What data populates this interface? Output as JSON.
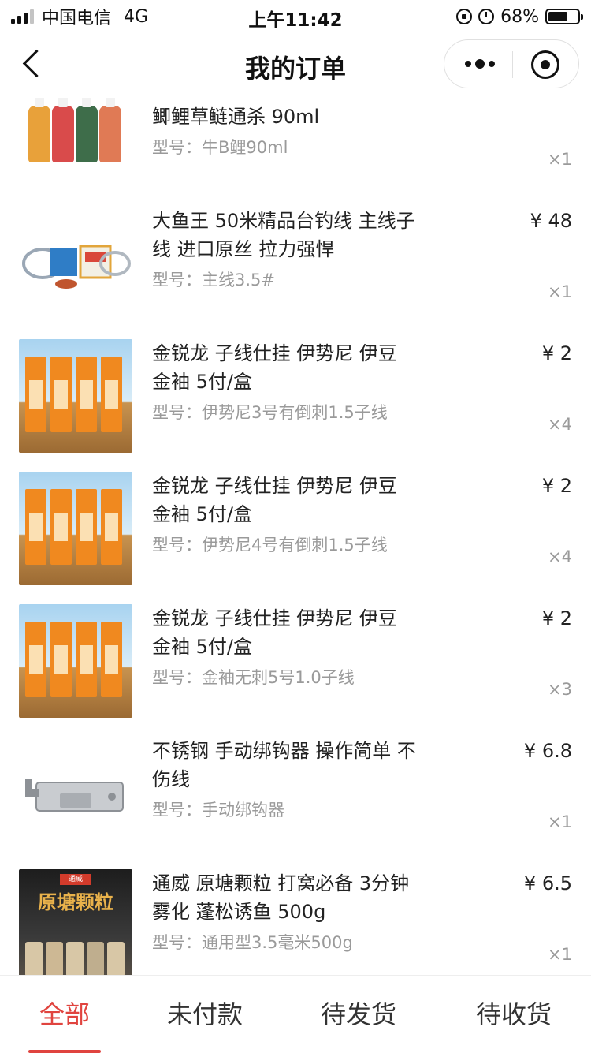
{
  "status_bar": {
    "carrier": "中国电信",
    "network": "4G",
    "time": "上午11:42",
    "battery": "68%",
    "battery_level": 0.68
  },
  "nav": {
    "title": "我的订单"
  },
  "items": [
    {
      "name": "鲫鲤草鲢通杀 90ml",
      "spec": "型号：牛B鲤90ml",
      "price": "",
      "qty": "×1",
      "thumb_icon": "bait-bottles-image"
    },
    {
      "name": "大鱼王 50米精品台钓线 主线子线 进口原丝 拉力强悍",
      "spec": "型号：主线3.5#",
      "price": "¥ 48",
      "qty": "×1",
      "thumb_icon": "fishing-line-image"
    },
    {
      "name": "金锐龙 子线仕挂 伊势尼 伊豆 金袖 5付/盒",
      "spec": "型号：伊势尼3号有倒刺1.5子线",
      "price": "¥ 2",
      "qty": "×4",
      "thumb_icon": "hook-boxes-image"
    },
    {
      "name": "金锐龙 子线仕挂 伊势尼 伊豆 金袖 5付/盒",
      "spec": "型号：伊势尼4号有倒刺1.5子线",
      "price": "¥ 2",
      "qty": "×4",
      "thumb_icon": "hook-boxes-image"
    },
    {
      "name": "金锐龙 子线仕挂 伊势尼 伊豆 金袖 5付/盒",
      "spec": "型号：金袖无刺5号1.0子线",
      "price": "¥ 2",
      "qty": "×3",
      "thumb_icon": "hook-boxes-image"
    },
    {
      "name": "不锈钢 手动绑钩器 操作简单 不伤线",
      "spec": "型号：手动绑钩器",
      "price": "¥ 6.8",
      "qty": "×1",
      "thumb_icon": "hook-tier-tool-image"
    },
    {
      "name": "通威 原塘颗粒 打窝必备 3分钟雾化 蓬松诱鱼 500g",
      "spec": "型号：通用型3.5毫米500g",
      "price": "¥ 6.5",
      "qty": "×1",
      "thumb_icon": "bait-bags-image",
      "thumb_title": "原塘颗粒",
      "thumb_tag": "通威"
    }
  ],
  "tabs": [
    {
      "label": "全部",
      "active": true
    },
    {
      "label": "未付款",
      "active": false
    },
    {
      "label": "待发货",
      "active": false
    },
    {
      "label": "待收货",
      "active": false
    }
  ],
  "colors": {
    "accent": "#e0443f",
    "secondary_text": "#9a9a9a"
  }
}
